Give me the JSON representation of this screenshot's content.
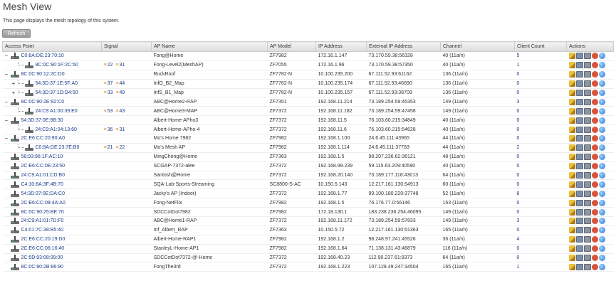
{
  "page": {
    "title": "Mesh View",
    "description": "This page displays the mesh topology of this system.",
    "refresh_label": "Refresh"
  },
  "table": {
    "headers": [
      "Access Point",
      "Signal",
      "AP Name",
      "AP Model",
      "IP Address",
      "External IP Address",
      "Channel",
      "Client Count",
      "Actions"
    ],
    "rows": [
      {
        "level": 0,
        "toggle": "−",
        "mac": "C0:8A:DE:23:70:10",
        "sig1": "",
        "sig2": "",
        "name": "Fong@Home",
        "model": "ZF7982",
        "ip": "172.16.1.147",
        "ext": "73.170.59.38:56328",
        "channel": "40 (11a/n)",
        "clients": "5",
        "sep": true
      },
      {
        "level": 1,
        "toggle": "",
        "mac": "8C:0C:90:1F:2C:50",
        "sig1": "22",
        "sig2": "31",
        "name": "Fong-Level2(MeshAP)",
        "model": "ZF7055",
        "ip": "172.16.1.96",
        "ext": "73.170.59.38:57350",
        "channel": "40 (11a/n)",
        "clients": "1",
        "sep": false
      },
      {
        "level": 0,
        "toggle": "−",
        "mac": "8C:0C:90:12:2C:D0",
        "sig1": "",
        "sig2": "",
        "name": "RuckRoof",
        "model": "ZF7782-N",
        "ip": "10.100.235.200",
        "ext": "67.111.52.93:61162",
        "channel": "136 (11a/n)",
        "clients": "0",
        "sep": true
      },
      {
        "level": 1,
        "toggle": "+",
        "mac": "54:3D:37:1E:5F:A0",
        "sig1": "37",
        "sig2": "44",
        "name": "InfO_B2_Map",
        "model": "ZF7782-N",
        "ip": "10.100.235.174",
        "ext": "67.111.52.93:46690",
        "channel": "136 (11a/n)",
        "clients": "0",
        "sep": false
      },
      {
        "level": 1,
        "toggle": "+",
        "mac": "54:3D:37:1D:D4:50",
        "sig1": "33",
        "sig2": "49",
        "name": "InfS_B1_Map",
        "model": "ZF7782-N",
        "ip": "10.100.235.157",
        "ext": "67.111.52.93:38709",
        "channel": "136 (11a/n)",
        "clients": "0",
        "sep": false
      },
      {
        "level": 0,
        "toggle": "−",
        "mac": "8C:0C:90:2E:92:C0",
        "sig1": "",
        "sig2": "",
        "name": "ABC@Home2-RAP",
        "model": "ZF7351",
        "ip": "192.168.11.214",
        "ext": "73.189.254.59:45353",
        "channel": "149 (11a/n)",
        "clients": "3",
        "sep": true
      },
      {
        "level": 1,
        "toggle": "",
        "mac": "24:C9:A1:00:39:E0",
        "sig1": "53",
        "sig2": "43",
        "name": "ABC@Home3-MAP",
        "model": "ZF7372",
        "ip": "192.168.11.182",
        "ext": "73.189.254.59:47458",
        "channel": "149 (11a/n)",
        "clients": "0",
        "sep": false
      },
      {
        "level": 0,
        "toggle": "−",
        "mac": "54:3D:37:0E:9B:30",
        "sig1": "",
        "sig2": "",
        "name": "Albert-Home-APho3",
        "model": "ZF7372",
        "ip": "192.168.11.5",
        "ext": "76.103.60.215:34849",
        "channel": "40 (11a/n)",
        "clients": "0",
        "sep": true
      },
      {
        "level": 1,
        "toggle": "",
        "mac": "24:C9:A1:04:13:60",
        "sig1": "36",
        "sig2": "31",
        "name": "Albert-Home-APho-4",
        "model": "ZF7372",
        "ip": "192.168.11.6",
        "ext": "76.103.60.215:54628",
        "channel": "40 (11a/n)",
        "clients": "0",
        "sep": false
      },
      {
        "level": 0,
        "toggle": "−",
        "mac": "2C:E6:CC:20:90:A0",
        "sig1": "",
        "sig2": "",
        "name": "Mo's Home 7982",
        "model": "ZF7982",
        "ip": "192.168.1.100",
        "ext": "24.6.45.111:43965",
        "channel": "44 (11a/n)",
        "clients": "0",
        "sep": true
      },
      {
        "level": 1,
        "toggle": "",
        "mac": "C0:8A:DE:23:7E:B0",
        "sig1": "21",
        "sig2": "22",
        "name": "Mo's Mesh AP",
        "model": "ZF7982",
        "ip": "192.168.1.114",
        "ext": "24.6.45.111:37783",
        "channel": "44 (11a/n)",
        "clients": "2",
        "sep": false
      },
      {
        "level": 0,
        "toggle": "",
        "mac": "58:93:96:1F:AC:10",
        "sig1": "",
        "sig2": "",
        "name": "MingChong@Home",
        "model": "ZF7363",
        "ip": "192.168.1.5",
        "ext": "98.207.236.62:36121",
        "channel": "48 (11a/n)",
        "clients": "0",
        "sep": true
      },
      {
        "level": 0,
        "toggle": "",
        "mac": "2C:E6:CC:0E:23:50",
        "sig1": "",
        "sig2": "",
        "name": "SCGAP-7372-alee",
        "model": "ZF7372",
        "ip": "192.168.99.239",
        "ext": "59.115.63.209:40590",
        "channel": "40 (11a/n)",
        "clients": "0",
        "sep": true
      },
      {
        "level": 0,
        "toggle": "",
        "mac": "24:C9:A1:01:CD:B0",
        "sig1": "",
        "sig2": "",
        "name": "Santosh@Home",
        "model": "ZF7372",
        "ip": "192.168.20.140",
        "ext": "73.189.177.118:43013",
        "channel": "64 (11a/n)",
        "clients": "0",
        "sep": true
      },
      {
        "level": 0,
        "toggle": "",
        "mac": "C4:10:8A:3F:4B:70",
        "sig1": "",
        "sig2": "",
        "name": "SQA-Lab-Sports-Streaming",
        "model": "SC8800-S-AC",
        "ip": "10.150.5.143",
        "ext": "12.217.161.130:54913",
        "channel": "60 (11a/n)",
        "clients": "0",
        "sep": true
      },
      {
        "level": 0,
        "toggle": "",
        "mac": "54:3D:37:0E:DA:C0",
        "sig1": "",
        "sig2": "",
        "name": "Jacky's AP (Indoor)",
        "model": "ZF7372",
        "ip": "192.168.1.77",
        "ext": "99.100.180.220:37748",
        "channel": "52 (11a/n)",
        "clients": "8",
        "sep": true
      },
      {
        "level": 0,
        "toggle": "",
        "mac": "2C:E6:CC:08:4A:A0",
        "sig1": "",
        "sig2": "",
        "name": "Fong-NetFlix",
        "model": "ZF7982",
        "ip": "192.168.1.5",
        "ext": "76.176.77.0:56146",
        "channel": "153 (11a/n)",
        "clients": "0",
        "sep": true
      },
      {
        "level": 0,
        "toggle": "",
        "mac": "8C:0C:90:25:BE:70",
        "sig1": "",
        "sig2": "",
        "name": "SDCCotDot7982",
        "model": "ZF7982",
        "ip": "172.18.130.1",
        "ext": "183.238.236.254:46095",
        "channel": "149 (11a/n)",
        "clients": "0",
        "sep": true
      },
      {
        "level": 0,
        "toggle": "",
        "mac": "24:C9:A1:01:7D:F0",
        "sig1": "",
        "sig2": "",
        "name": "ABC@Home1-RAP",
        "model": "ZF7372",
        "ip": "192.168.11.172",
        "ext": "73.189.254.59:57833",
        "channel": "149 (11a/n)",
        "clients": "3",
        "sep": true
      },
      {
        "level": 0,
        "toggle": "",
        "mac": "C4:01:7C:38:B5:40",
        "sig1": "",
        "sig2": "",
        "name": "Inf_Albert_RAP",
        "model": "ZF7363",
        "ip": "10.150.5.72",
        "ext": "12.217.161.130:51363",
        "channel": "165 (11a/n)",
        "clients": "0",
        "sep": true
      },
      {
        "level": 0,
        "toggle": "",
        "mac": "2C:E6:CC:20:19:D0",
        "sig1": "",
        "sig2": "",
        "name": "Albert-Home-RAP1",
        "model": "ZF7982",
        "ip": "192.168.1.2",
        "ext": "98.248.97.241:45526",
        "channel": "36 (11a/n)",
        "clients": "4",
        "sep": true
      },
      {
        "level": 0,
        "toggle": "",
        "mac": "2C:E6:CC:06:16:40",
        "sig1": "",
        "sig2": "",
        "name": "StanleyL-Home-AP1",
        "model": "ZF7982",
        "ip": "192.168.1.64",
        "ext": "71.138.131.43:46879",
        "channel": "116 (11a/n)",
        "clients": "0",
        "sep": true
      },
      {
        "level": 0,
        "toggle": "",
        "mac": "2C:5D:93:08:99:00",
        "sig1": "",
        "sig2": "",
        "name": "SDCCotDot7372-@-Home",
        "model": "ZF7372",
        "ip": "192.168.40.23",
        "ext": "112.90.237.61:8373",
        "channel": "64 (11a/n)",
        "clients": "0",
        "sep": true
      },
      {
        "level": 0,
        "toggle": "",
        "mac": "8C:0C:90:2B:86:90",
        "sig1": "",
        "sig2": "",
        "name": "FongThe3rd",
        "model": "ZF7372",
        "ip": "192.168.1.223",
        "ext": "107.128.49.247:34504",
        "channel": "165 (11a/n)",
        "clients": "1",
        "sep": true
      }
    ]
  },
  "icons": {
    "ap": "access-point-icon",
    "signal": "wifi-signal-icon",
    "actions": [
      "edit-pencil-icon",
      "monitor-icon",
      "clients-icon",
      "restart-icon",
      "globe-icon"
    ]
  },
  "colors": {
    "link": "#1a3e8c",
    "signal_icon": "#e08a1c"
  }
}
